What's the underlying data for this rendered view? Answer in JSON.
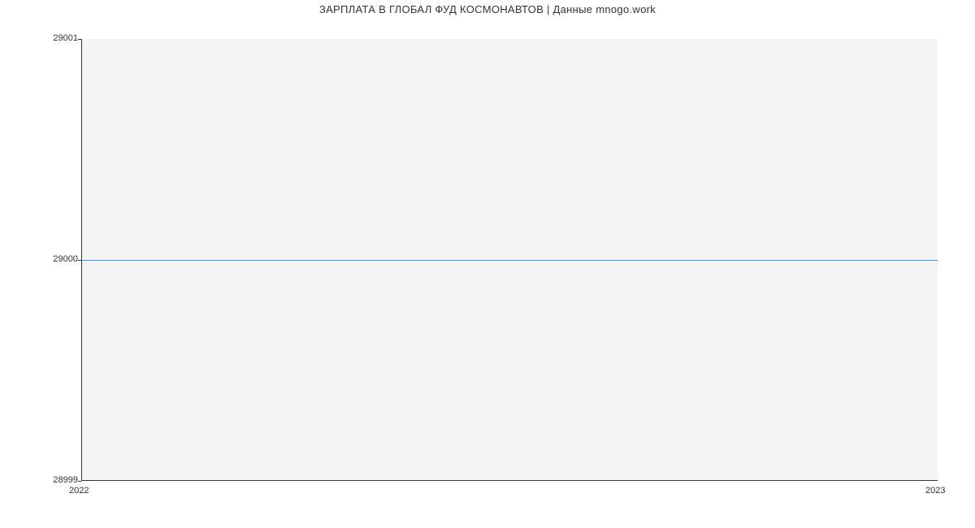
{
  "title": "ЗАРПЛАТА В ГЛОБАЛ ФУД КОСМОНАВТОВ | Данные mnogo.work",
  "chart_data": {
    "type": "line",
    "x": [
      2022,
      2023
    ],
    "values": [
      29000,
      29000
    ],
    "yticks": [
      28999,
      29000,
      29001
    ],
    "xticks": [
      2022,
      2023
    ],
    "ylim": [
      28999,
      29001
    ],
    "xlabel": "",
    "ylabel": ""
  }
}
